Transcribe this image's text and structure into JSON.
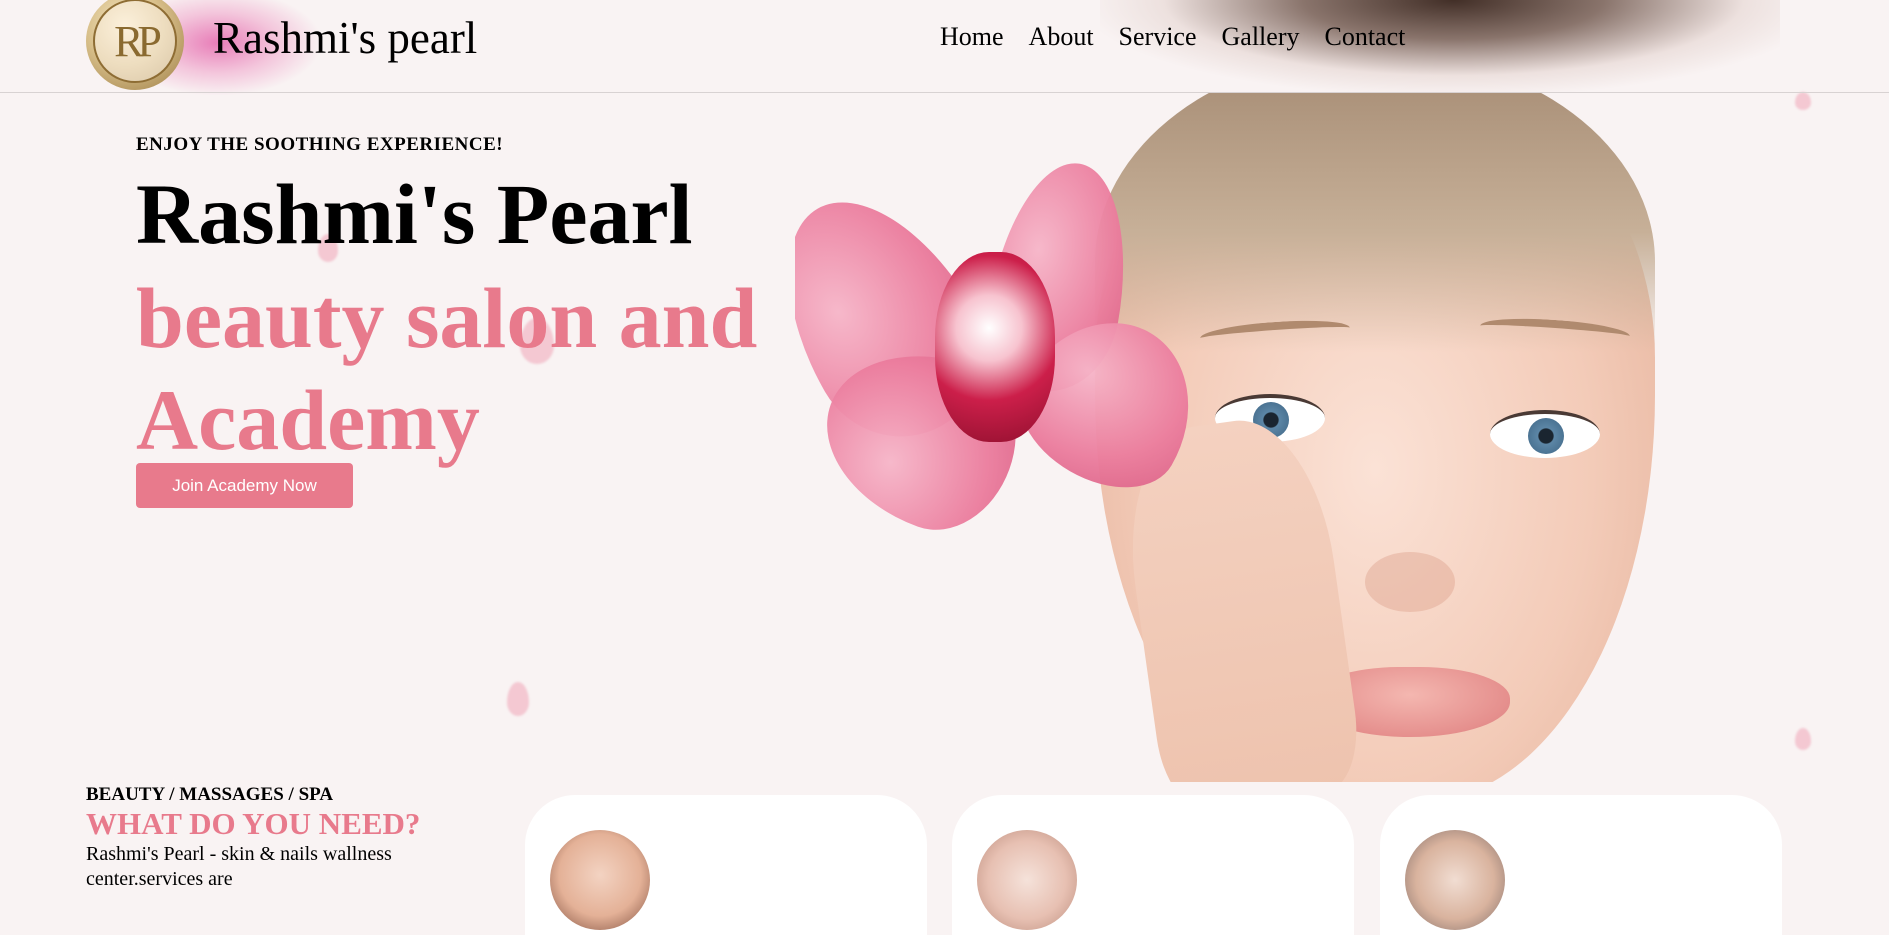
{
  "header": {
    "logo_monogram": "RP",
    "brand": "Rashmi's pearl",
    "nav": [
      {
        "label": "Home"
      },
      {
        "label": "About"
      },
      {
        "label": "Service"
      },
      {
        "label": "Gallery"
      },
      {
        "label": "Contact"
      }
    ]
  },
  "hero": {
    "tagline": "ENJOY THE SOOTHING EXPERIENCE!",
    "title_line1": "Rashmi's Pearl",
    "title_line2": "beauty salon and Academy",
    "cta_label": "Join Academy Now",
    "accent_color": "#e87a8c"
  },
  "services": {
    "kicker": "BEAUTY / MASSAGES / SPA",
    "heading": "WHAT DO YOU NEED?",
    "description": "Rashmi's Pearl - skin & nails wallness center.services are",
    "cards": [
      {
        "icon": "facial-photo"
      },
      {
        "icon": "nails-photo"
      },
      {
        "icon": "massage-photo"
      }
    ]
  }
}
